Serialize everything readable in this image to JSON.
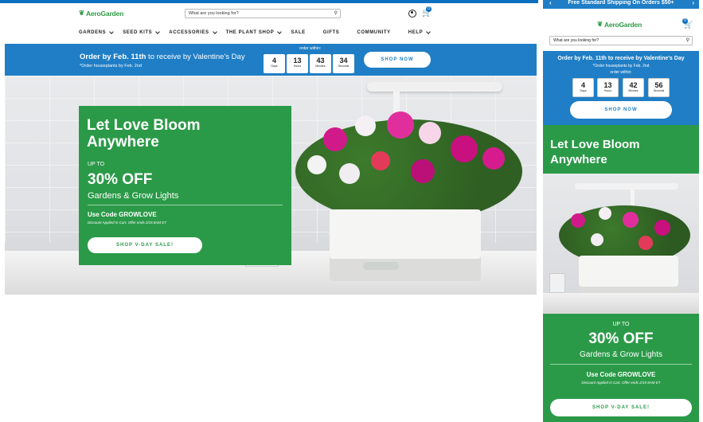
{
  "colors": {
    "brand_green": "#2b9a48",
    "brand_blue": "#1f7ec5",
    "top_blue": "#0b6fbf"
  },
  "desktop": {
    "logo": "AeroGarden",
    "search": {
      "placeholder": "What are you looking for?"
    },
    "cart_count": "0",
    "nav": [
      {
        "label": "GARDENS",
        "dropdown": true
      },
      {
        "label": "SEED KITS",
        "dropdown": true
      },
      {
        "label": "ACCESSORIES",
        "dropdown": true
      },
      {
        "label": "THE PLANT SHOP",
        "dropdown": true
      },
      {
        "label": "SALE",
        "dropdown": false
      },
      {
        "label": "GIFTS",
        "dropdown": false
      },
      {
        "label": "COMMUNITY",
        "dropdown": false
      },
      {
        "label": "HELP",
        "dropdown": true
      }
    ],
    "promo": {
      "headline_bold": "Order by Feb. 11th",
      "headline_rest": " to receive by Valentine's Day",
      "sub": "*Order houseplants by Feb. 2nd",
      "within": "order within:",
      "countdown": [
        {
          "value": "4",
          "label": "Days"
        },
        {
          "value": "13",
          "label": "Hours"
        },
        {
          "value": "43",
          "label": "Minutes"
        },
        {
          "value": "34",
          "label": "Seconds"
        }
      ],
      "cta": "SHOP NOW"
    },
    "hero": {
      "title": "Let Love Bloom Anywhere",
      "up_to": "UP TO",
      "percent": "30% OFF",
      "subtitle": "Gardens & Grow Lights",
      "code": "Use Code GROWLOVE",
      "disclaimer": "Discount Applied in Cart. Offer ends 2/15 8AM ET",
      "cta": "SHOP V-DAY SALE!"
    }
  },
  "mobile": {
    "top_bar": "Free Standard Shipping On Orders $50+",
    "logo": "AeroGarden",
    "cart_count": "0",
    "search": {
      "placeholder": "What are you looking for?"
    },
    "promo": {
      "headline": "Order by Feb. 11th to receive by Valentine's Day",
      "sub": "*Order houseplants by Feb. 2nd",
      "within": "order within:",
      "countdown": [
        {
          "value": "4",
          "label": "Days"
        },
        {
          "value": "13",
          "label": "Hours"
        },
        {
          "value": "42",
          "label": "Minutes"
        },
        {
          "value": "56",
          "label": "Seconds"
        }
      ],
      "cta": "SHOP NOW"
    },
    "hero": {
      "title": "Let Love Bloom Anywhere",
      "up_to": "UP TO",
      "percent": "30% OFF",
      "subtitle": "Gardens & Grow Lights",
      "code": "Use Code GROWLOVE",
      "disclaimer": "Discount Applied in Cart. Offer ends 2/15 8AM ET",
      "cta": "SHOP V-DAY SALE!"
    }
  }
}
